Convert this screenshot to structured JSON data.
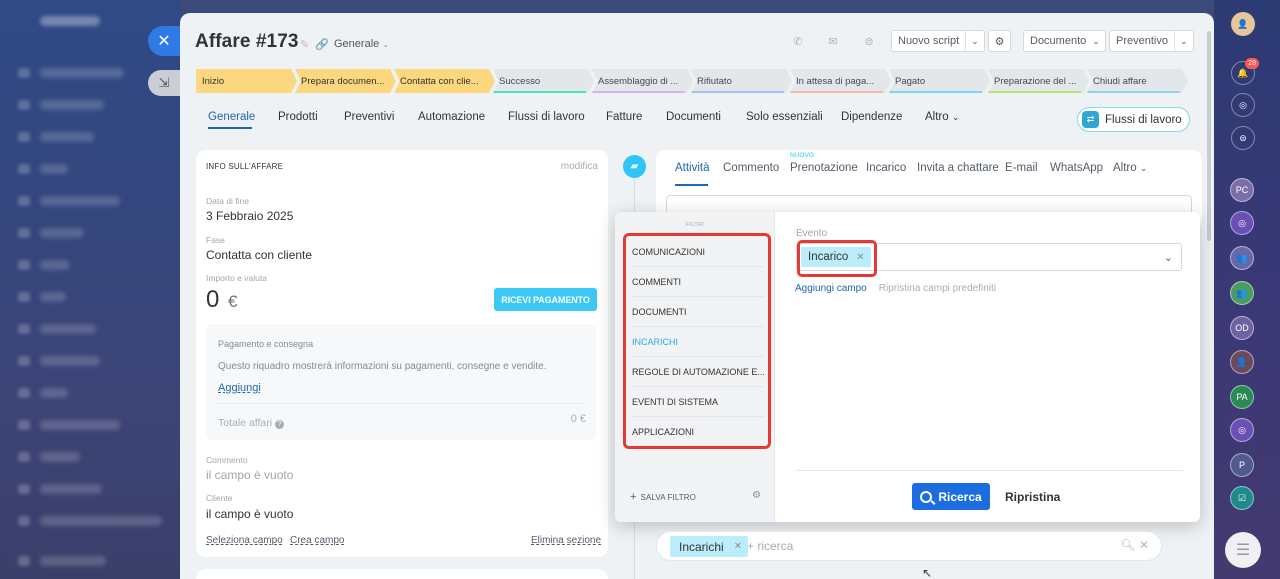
{
  "window": {
    "title": "Affare #173",
    "category": "Generale",
    "close_icon": "close-icon",
    "minimize_icon": "minimize-icon"
  },
  "toolbar": {
    "nuovo_script": "Nuovo script",
    "documento": "Documento",
    "preventivo": "Preventivo"
  },
  "stages": [
    {
      "label": "Inizio",
      "state": "active",
      "color": "#fdd77d"
    },
    {
      "label": "Prepara documen...",
      "state": "active",
      "color": "#fdd77d"
    },
    {
      "label": "Contatta con clie...",
      "state": "active",
      "color": "#fdd77d"
    },
    {
      "label": "Successo",
      "state": "inactive",
      "color": "#47e4c2"
    },
    {
      "label": "Assemblaggio di ...",
      "state": "inactive",
      "color": "#d3b4f5"
    },
    {
      "label": "Rifiutato",
      "state": "inactive",
      "color": "#9ec3f0"
    },
    {
      "label": "In attesa di paga...",
      "state": "inactive",
      "color": "#ffb5a3"
    },
    {
      "label": "Pagato",
      "state": "inactive",
      "color": "#7bd5f7"
    },
    {
      "label": "Preparazione del ...",
      "state": "inactive",
      "color": "#b6e67a"
    },
    {
      "label": "Chiudi affare",
      "state": "inactive",
      "color": "#8fd3f0"
    }
  ],
  "tabs": {
    "generale": "Generale",
    "prodotti": "Prodotti",
    "preventivi": "Preventivi",
    "automazione": "Automazione",
    "flussi": "Flussi di lavoro",
    "fatture": "Fatture",
    "documenti": "Documenti",
    "essenziali": "Solo essenziali",
    "dipendenze": "Dipendenze",
    "altro": "Altro",
    "flussi_btn": "Flussi di lavoro"
  },
  "info": {
    "header": "INFO SULL'AFFARE",
    "edit": "modifica",
    "data_fine_label": "Data di fine",
    "data_fine_value": "3 Febbraio 2025",
    "fase_label": "Fase",
    "fase_value": "Contatta con cliente",
    "importo_label": "Importo e valuta",
    "importo_value": "0",
    "currency": "€",
    "pay_button": "RICEVI PAGAMENTO",
    "pagamento_title": "Pagamento e consegna",
    "pagamento_text": "Questo riquadro mostrerà informazioni su pagamenti, consegne e vendite.",
    "aggiungi": "Aggiungi",
    "totale_label": "Totale affari",
    "totale_value": "0 €",
    "commento_label": "Commento",
    "commento_value": "il campo è vuoto",
    "cliente_label": "Cliente",
    "cliente_value": "il campo è vuoto",
    "seleziona_campo": "Seleziona campo",
    "crea_campo": "Crea campo",
    "elimina_sezione": "Elimina sezione"
  },
  "activity": {
    "tabs": [
      "Attività",
      "Commento",
      "Prenotazione",
      "Incarico",
      "Invita a chattare",
      "E-mail",
      "WhatsApp",
      "Altro"
    ],
    "nuovo_badge": "NUOVO"
  },
  "filter": {
    "title": "FILTRI",
    "items": [
      "COMUNICAZIONI",
      "COMMENTI",
      "DOCUMENTI",
      "INCARICHI",
      "REGOLE DI AUTOMAZIONE E...",
      "EVENTI DI SISTEMA",
      "APPLICAZIONI"
    ],
    "selected_index": 3,
    "save_filter": "SALVA FILTRO",
    "evento_label": "Evento",
    "evento_tag": "Incarico",
    "aggiungi_campo": "Aggiungi campo",
    "ripristina_campi": "Ripristina campi predefiniti",
    "search_button": "Ricerca",
    "reset_button": "Ripristina"
  },
  "searchbar": {
    "tag": "Incarichi",
    "placeholder": "+ ricerca"
  },
  "rightbar": {
    "notif_count": "28",
    "avatars": [
      "PC",
      "OD",
      "PA",
      "P"
    ]
  },
  "colors": {
    "accent": "#2067b0",
    "stage_active": "#fdd77d",
    "button_blue": "#1c6ee0",
    "pay_button": "#3bc8f5",
    "highlight_red": "#e53935"
  }
}
